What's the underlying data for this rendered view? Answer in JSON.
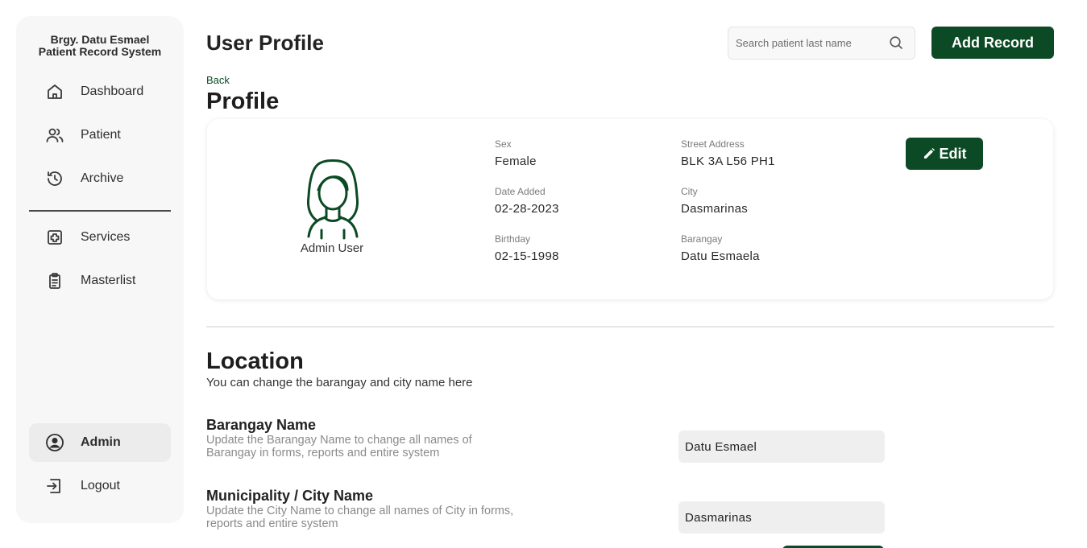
{
  "sidebar": {
    "brand_line1": "Brgy. Datu Esmael",
    "brand_line2": "Patient Record System",
    "items": [
      {
        "label": "Dashboard",
        "icon": "home-icon"
      },
      {
        "label": "Patient",
        "icon": "users-icon"
      },
      {
        "label": "Archive",
        "icon": "history-icon"
      },
      {
        "label": "Services",
        "icon": "medical-plus-icon"
      },
      {
        "label": "Masterlist",
        "icon": "clipboard-icon"
      }
    ],
    "admin_label": "Admin",
    "logout_label": "Logout"
  },
  "header": {
    "title": "User Profile",
    "search_placeholder": "Search patient last name",
    "add_record_label": "Add Record"
  },
  "profile": {
    "back_label": "Back",
    "heading": "Profile",
    "name": "Admin User",
    "edit_label": "Edit",
    "fields": {
      "sex_label": "Sex",
      "sex_value": "Female",
      "date_added_label": "Date Added",
      "date_added_value": "02-28-2023",
      "birthday_label": "Birthday",
      "birthday_value": "02-15-1998",
      "street_label": "Street Address",
      "street_value": "BLK 3A L56 PH1",
      "city_label": "City",
      "city_value": "Dasmarinas",
      "barangay_label": "Barangay",
      "barangay_value": "Datu Esmaela"
    }
  },
  "location": {
    "heading": "Location",
    "subtitle": "You can change the barangay and city name here",
    "barangay_title": "Barangay Name",
    "barangay_desc": "Update the Barangay Name to change all names of Barangay in forms, reports and entire system",
    "barangay_value": "Datu Esmael",
    "city_title": "Municipality / City Name",
    "city_desc": "Update the City Name to change all names of City in forms, reports and entire system",
    "city_value": "Dasmarinas"
  },
  "colors": {
    "brand_green": "#0b4a24",
    "sidebar_bg": "#f7f7f7",
    "input_bg": "#efefef"
  }
}
